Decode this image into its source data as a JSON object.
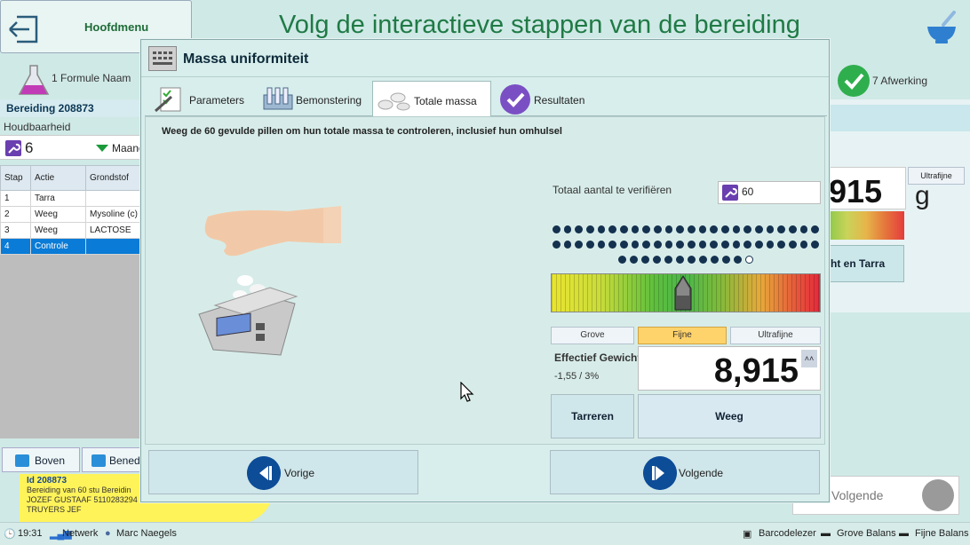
{
  "header": {
    "main_menu": "Hoofdmenu",
    "page_title": "Volg de interactieve stappen van de bereiding"
  },
  "steps": {
    "formula": "1  Formule Naam",
    "finish": "7  Afwerking"
  },
  "left_panel": {
    "prep_title": "Bereiding 208873",
    "shelf_life_label": "Houdbaarheid",
    "shelf_life_value": "6",
    "shelf_life_unit": "Maand",
    "table": {
      "headers": [
        "Stap",
        "Actie",
        "Grondstof"
      ],
      "rows": [
        [
          "1",
          "Tarra",
          ""
        ],
        [
          "2",
          "Weeg",
          "Mysoline (c)"
        ],
        [
          "3",
          "Weeg",
          "LACTOSE"
        ],
        [
          "4",
          "Controle",
          ""
        ]
      ],
      "selected_row": 3
    },
    "btn_top": "Boven",
    "btn_down": "Bened"
  },
  "sticky_note": {
    "id": "Id 208873",
    "line1": "Bereiding van 60 stu Bereidin",
    "line2": "JOZEF GUSTAAF 5110283294",
    "line3": "TRUYERS JEF"
  },
  "right_panel": {
    "value": "915",
    "unit": "g",
    "ultra": "Ultrafijne",
    "button": "ht en Tarra"
  },
  "bottom_next": "Volgende",
  "taskbar": {
    "time": "19:31",
    "network": "Netwerk",
    "user": "Marc Naegels",
    "barcode": "Barcodelezer",
    "coarse_balance": "Grove Balans",
    "fine_balance": "Fijne Balans"
  },
  "modal": {
    "title": "Massa uniformiteit",
    "tabs": [
      "Parameters",
      "Bemonstering",
      "Totale massa",
      "Resultaten"
    ],
    "active_tab": 2,
    "instruction": "Weeg de 60 gevulde pillen om hun totale massa te controleren, inclusief hun omhulsel",
    "verify_label": "Totaal aantal te verifiëren",
    "verify_value": "60",
    "dots": {
      "total": 60,
      "filled": 59,
      "per_row": 24
    },
    "gauge_pointer_fraction": 0.49,
    "modes": [
      "Grove",
      "Fijne",
      "Ultrafijne"
    ],
    "active_mode": "Fijne",
    "effective_label": "Effectief Gewicht",
    "tolerance": "-1,55 / 3%",
    "weight": "8,915",
    "btn_tare": "Tarreren",
    "btn_weigh": "Weeg",
    "btn_prev": "Vorige",
    "btn_next": "Volgende"
  },
  "colors": {
    "title_green": "#1f7a45",
    "nav_blue": "#0d4c97",
    "selected_row": "#0a7bd6",
    "active_mode": "#ffd36b"
  }
}
